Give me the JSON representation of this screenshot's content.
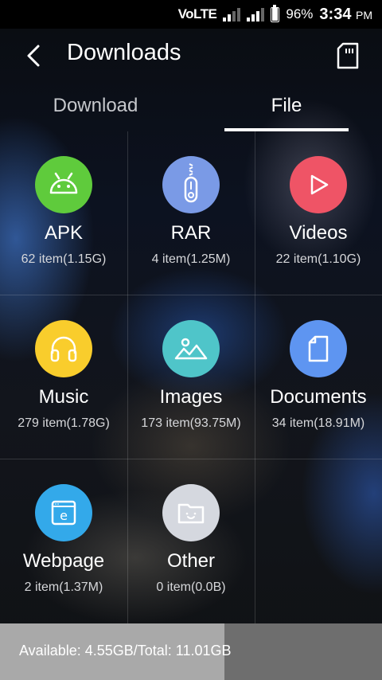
{
  "status_bar": {
    "network": "VoLTE",
    "battery": "96%",
    "battery_level": 0.96,
    "time": "3:34",
    "ampm": "PM"
  },
  "header": {
    "title": "Downloads",
    "back_icon": "chevron-left-icon",
    "sd_icon": "sd-card-icon"
  },
  "tabs": [
    {
      "label": "Download",
      "selected": false
    },
    {
      "label": "File",
      "selected": true
    }
  ],
  "categories": [
    {
      "name": "APK",
      "count": "62  item(1.15G)",
      "icon": "android-icon",
      "color": "#5fcb3c"
    },
    {
      "name": "RAR",
      "count": "4  item(1.25M)",
      "icon": "zipper-icon",
      "color": "#7a9ae6"
    },
    {
      "name": "Videos",
      "count": "22  item(1.10G)",
      "icon": "play-icon",
      "color": "#ef5466"
    },
    {
      "name": "Music",
      "count": "279  item(1.78G)",
      "icon": "headphones-icon",
      "color": "#f9cd2c"
    },
    {
      "name": "Images",
      "count": "173  item(93.75M)",
      "icon": "image-icon",
      "color": "#4fc5c9"
    },
    {
      "name": "Documents",
      "count": "34  item(18.91M)",
      "icon": "document-icon",
      "color": "#5e95f1"
    },
    {
      "name": "Webpage",
      "count": "2  item(1.37M)",
      "icon": "webpage-icon",
      "color": "#33a9ea"
    },
    {
      "name": "Other",
      "count": "0  item(0.0B)",
      "icon": "folder-smile-icon",
      "color": "#d5d8df"
    }
  ],
  "storage": {
    "text": "Available: 4.55GB/Total: 11.01GB",
    "used_fraction": 0.587
  }
}
